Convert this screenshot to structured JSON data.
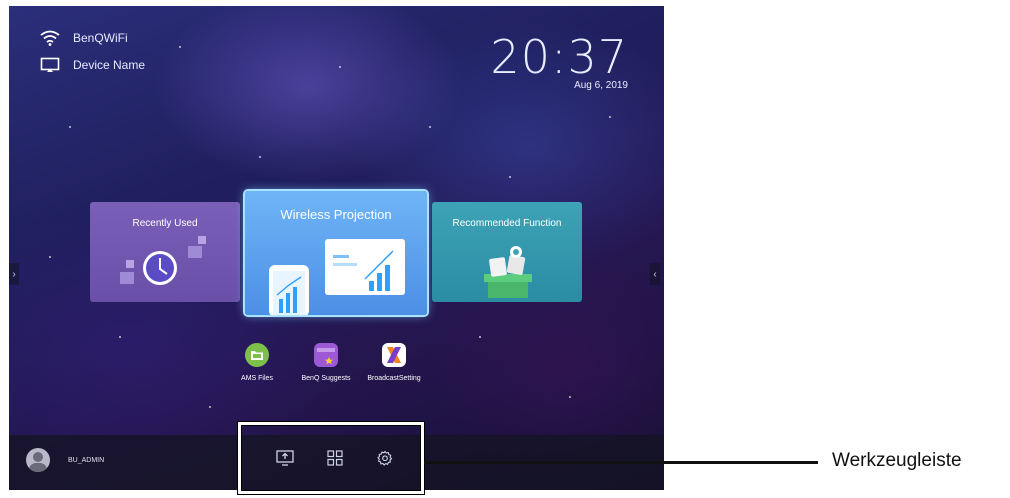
{
  "status": {
    "wifi_name": "BenQWiFi",
    "device_name": "Device Name",
    "wifi_icon": "wifi-icon",
    "device_icon": "cast-screen-icon"
  },
  "clock": {
    "time": "20:37",
    "date": "Aug 6, 2019"
  },
  "cards": {
    "recent": "Recently Used",
    "wireless": "Wireless Projection",
    "recommend": "Recommended Function"
  },
  "apps": [
    {
      "label": "AMS Files",
      "icon": "folder-app-icon",
      "color": "#7cc04a"
    },
    {
      "label": "BenQ Suggests",
      "icon": "shopping-bag-star-icon",
      "color": "#9b59d6"
    },
    {
      "label": "BroadcastSetting",
      "icon": "broadcast-x-icon",
      "color": "#ffffff"
    }
  ],
  "user": {
    "name": "BU_ADMIN"
  },
  "toolbar": {
    "buttons": [
      "screen-share-icon",
      "apps-grid-icon",
      "settings-gear-icon"
    ]
  },
  "callout": {
    "label": "Werkzeugleiste"
  },
  "colors": {
    "wireless_card": "#5aa0ee",
    "recent_card": "#7058b0",
    "recommend_card": "#3598ad"
  }
}
